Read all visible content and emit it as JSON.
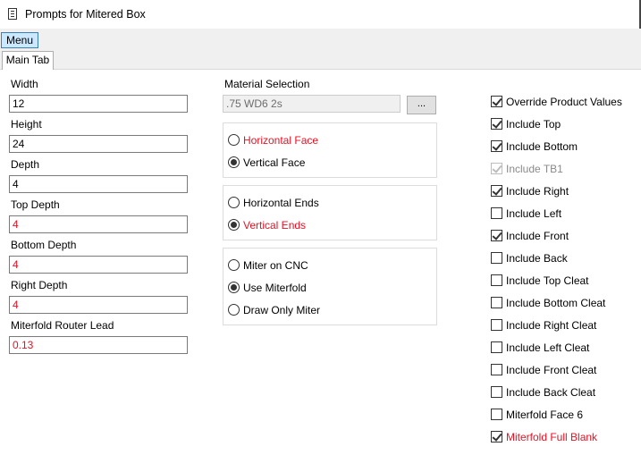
{
  "window": {
    "title": "Prompts for Mitered Box"
  },
  "menu": {
    "label": "Menu"
  },
  "tabs": [
    {
      "label": "Main Tab"
    }
  ],
  "fields": [
    {
      "label": "Width",
      "value": "12",
      "highlight": false
    },
    {
      "label": "Height",
      "value": "24",
      "highlight": false
    },
    {
      "label": "Depth",
      "value": "4",
      "highlight": false
    },
    {
      "label": "Top Depth",
      "value": "4",
      "highlight": true
    },
    {
      "label": "Bottom Depth",
      "value": "4",
      "highlight": true
    },
    {
      "label": "Right Depth",
      "value": "4",
      "highlight": true
    },
    {
      "label": "Miterfold Router Lead",
      "value": "0.13",
      "highlight": true
    }
  ],
  "material": {
    "label": "Material Selection",
    "value": ".75 WD6 2s",
    "browse_label": "..."
  },
  "face_group": [
    {
      "label": "Horizontal Face",
      "selected": false,
      "highlight": true
    },
    {
      "label": "Vertical Face",
      "selected": true,
      "highlight": false
    }
  ],
  "ends_group": [
    {
      "label": "Horizontal Ends",
      "selected": false,
      "highlight": false
    },
    {
      "label": "Vertical Ends",
      "selected": true,
      "highlight": true
    }
  ],
  "miter_group": [
    {
      "label": "Miter on CNC",
      "selected": false,
      "highlight": false
    },
    {
      "label": "Use Miterfold",
      "selected": true,
      "highlight": false
    },
    {
      "label": "Draw Only Miter",
      "selected": false,
      "highlight": false
    }
  ],
  "options": [
    {
      "label": "Override Product Values",
      "checked": true,
      "disabled": false,
      "highlight": false
    },
    {
      "label": "Include Top",
      "checked": true,
      "disabled": false,
      "highlight": false
    },
    {
      "label": "Include Bottom",
      "checked": true,
      "disabled": false,
      "highlight": false
    },
    {
      "label": "Include TB1",
      "checked": true,
      "disabled": true,
      "highlight": false
    },
    {
      "label": "Include Right",
      "checked": true,
      "disabled": false,
      "highlight": false
    },
    {
      "label": "Include Left",
      "checked": false,
      "disabled": false,
      "highlight": false
    },
    {
      "label": "Include Front",
      "checked": true,
      "disabled": false,
      "highlight": false
    },
    {
      "label": "Include Back",
      "checked": false,
      "disabled": false,
      "highlight": false
    },
    {
      "label": "Include Top Cleat",
      "checked": false,
      "disabled": false,
      "highlight": false
    },
    {
      "label": "Include Bottom Cleat",
      "checked": false,
      "disabled": false,
      "highlight": false
    },
    {
      "label": "Include Right Cleat",
      "checked": false,
      "disabled": false,
      "highlight": false
    },
    {
      "label": "Include Left Cleat",
      "checked": false,
      "disabled": false,
      "highlight": false
    },
    {
      "label": "Include Front Cleat",
      "checked": false,
      "disabled": false,
      "highlight": false
    },
    {
      "label": "Include Back Cleat",
      "checked": false,
      "disabled": false,
      "highlight": false
    },
    {
      "label": "Miterfold Face 6",
      "checked": false,
      "disabled": false,
      "highlight": false
    },
    {
      "label": "Miterfold Full Blank",
      "checked": true,
      "disabled": false,
      "highlight": true
    }
  ],
  "colors": {
    "highlight": "#e81123",
    "menu_active": "#cce8ff"
  }
}
